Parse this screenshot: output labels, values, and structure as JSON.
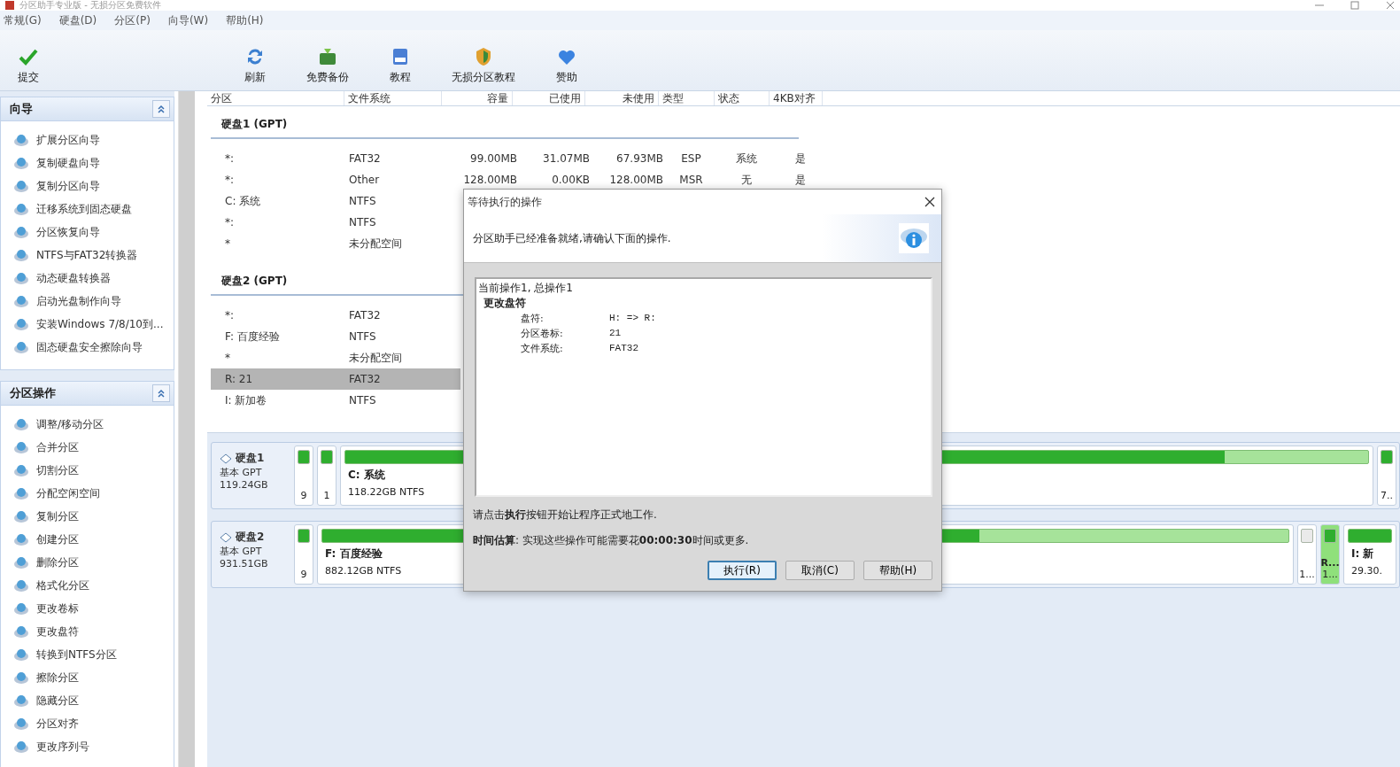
{
  "window": {
    "title": "分区助手专业版 - 无损分区免费软件"
  },
  "menu": [
    "常规(G)",
    "硬盘(D)",
    "分区(P)",
    "向导(W)",
    "帮助(H)"
  ],
  "toolbar": [
    {
      "label": "提交",
      "kind": "check"
    },
    {
      "label": "刷新",
      "kind": "refresh"
    },
    {
      "label": "免费备份",
      "kind": "backup"
    },
    {
      "label": "教程",
      "kind": "book"
    },
    {
      "label": "无损分区教程",
      "kind": "shield"
    },
    {
      "label": "赞助",
      "kind": "heart"
    }
  ],
  "sidebar": {
    "sections": [
      {
        "title": "向导",
        "expanded": true,
        "items": [
          "扩展分区向导",
          "复制硬盘向导",
          "复制分区向导",
          "迁移系统到固态硬盘",
          "分区恢复向导",
          "NTFS与FAT32转换器",
          "动态硬盘转换器",
          "启动光盘制作向导",
          "安装Windows 7/8/10到...",
          "固态硬盘安全擦除向导"
        ]
      },
      {
        "title": "分区操作",
        "expanded": true,
        "items": [
          "调整/移动分区",
          "合并分区",
          "切割分区",
          "分配空闲空间",
          "复制分区",
          "创建分区",
          "删除分区",
          "格式化分区",
          "更改卷标",
          "更改盘符",
          "转换到NTFS分区",
          "擦除分区",
          "隐藏分区",
          "分区对齐",
          "更改序列号"
        ]
      }
    ]
  },
  "table": {
    "columns": [
      "分区",
      "文件系统",
      "容量",
      "已使用",
      "未使用",
      "类型",
      "状态",
      "4KB对齐"
    ],
    "disks": [
      {
        "title": "硬盘1 (GPT)",
        "rows": [
          {
            "cells": [
              "*:",
              "FAT32",
              "99.00MB",
              "31.07MB",
              "67.93MB",
              "ESP",
              "系统",
              "是"
            ],
            "selected": false
          },
          {
            "cells": [
              "*:",
              "Other",
              "128.00MB",
              "0.00KB",
              "128.00MB",
              "MSR",
              "无",
              "是"
            ],
            "selected": false
          },
          {
            "cells": [
              "C: 系统",
              "NTFS"
            ],
            "selected": false
          },
          {
            "cells": [
              "*:",
              "NTFS"
            ],
            "selected": false
          },
          {
            "cells": [
              "*",
              "未分配空间"
            ],
            "selected": false
          }
        ]
      },
      {
        "title": "硬盘2 (GPT)",
        "rows": [
          {
            "cells": [
              "*:",
              "FAT32"
            ],
            "selected": false
          },
          {
            "cells": [
              "F: 百度经验",
              "NTFS"
            ],
            "selected": false
          },
          {
            "cells": [
              "*",
              "未分配空间"
            ],
            "selected": false
          },
          {
            "cells": [
              "R: 21",
              "FAT32"
            ],
            "selected": true
          },
          {
            "cells": [
              "I: 新加卷",
              "NTFS"
            ],
            "selected": false
          }
        ]
      }
    ]
  },
  "disk_map": [
    {
      "name": "硬盘1",
      "type": "基本 GPT",
      "size": "119.24GB",
      "partitions": [
        {
          "kind": "small",
          "lines": [
            "9"
          ],
          "level": 1,
          "selected": false
        },
        {
          "kind": "small",
          "lines": [
            "1"
          ],
          "level": 1,
          "selected": false
        },
        {
          "kind": "main",
          "name": "C: 系统",
          "info": "118.22GB NTFS",
          "level": 0.86
        },
        {
          "kind": "small",
          "lines": [
            "7.."
          ],
          "level": 1,
          "selected": false
        }
      ]
    },
    {
      "name": "硬盘2",
      "type": "基本 GPT",
      "size": "931.51GB",
      "partitions": [
        {
          "kind": "small",
          "lines": [
            "9"
          ],
          "level": 1,
          "selected": false
        },
        {
          "kind": "main",
          "name": "F: 百度经验",
          "info": "882.12GB NTFS",
          "level": 0.68
        },
        {
          "kind": "small",
          "lines": [
            "1..."
          ],
          "selected": false
        },
        {
          "kind": "small",
          "lines": [
            "R...",
            "1..."
          ],
          "level": 1,
          "selected": true
        },
        {
          "kind": "edge",
          "name": "I: 新",
          "info": "29.30.",
          "level": 1
        }
      ]
    }
  ],
  "dialog": {
    "title": "等待执行的操作",
    "message": "分区助手已经准备就绪,请确认下面的操作.",
    "summary": "当前操作1, 总操作1",
    "operation": "更改盘符",
    "details": [
      {
        "label": "盘符:",
        "value": "H: => R:"
      },
      {
        "label": "分区卷标:",
        "value": "21"
      },
      {
        "label": "文件系统:",
        "value": "FAT32"
      }
    ],
    "prompt": "请点击**执行**按钮开始让程序正式地工作.",
    "estimate": "**时间估算**: 实现这些操作可能需要花**00:00:30**时间或更多.",
    "buttons": [
      {
        "label": "执行(R)",
        "default": true
      },
      {
        "label": "取消(C)",
        "default": false
      },
      {
        "label": "帮助(H)",
        "default": false
      }
    ]
  }
}
